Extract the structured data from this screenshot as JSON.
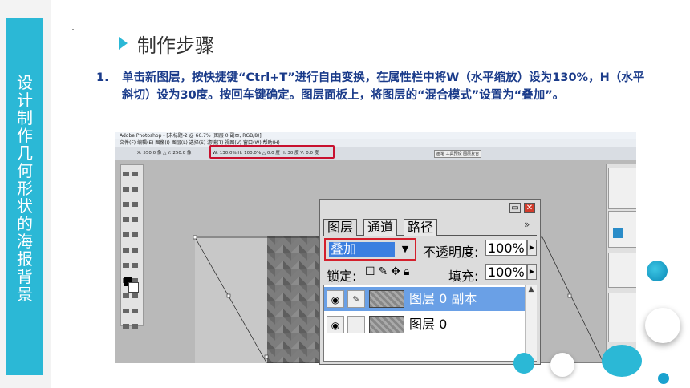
{
  "sidebar": {
    "title_chars": [
      "设",
      "计",
      "制",
      "作",
      "几",
      "何",
      "形",
      "状",
      "的",
      "海",
      "报",
      "背",
      "景"
    ]
  },
  "heading": {
    "text": "制作步骤"
  },
  "step": {
    "number": "1.",
    "text": "单击新图层，按快捷键“Ctrl+T”进行自由变换，在属性栏中将W（水平缩放）设为130%，H（水平斜切）设为30度。按回车键确定。图层面板上，将图层的“混合模式”设置为“叠加”。"
  },
  "screenshot": {
    "ps_title": "Adobe Photoshop - [未标题-2 @ 66.7% (图层 0 副本, RGB/8)]",
    "ps_menu": "文件(F)  编辑(E)  图像(I)  图层(L)  选择(S)  滤镜(T)  视图(V)  窗口(W)  帮助(H)",
    "opts_xy": "X: 550.0 像 △ Y: 250.0 像",
    "opts_wh": "W: 130.0%  H: 100.0%  △ 0.0  度  H: 30  度  V: 0.0  度",
    "opts_tabs": "画笔 工具预设 图层复合"
  },
  "layers_panel": {
    "tabs": [
      "图层",
      "通道",
      "路径"
    ],
    "more_label": "»",
    "blend_mode": "叠加",
    "opacity_label": "不透明度:",
    "opacity_value": "100%",
    "lock_label": "锁定:",
    "fill_label": "填充:",
    "fill_value": "100%",
    "layers": [
      {
        "name": "图层 0 副本",
        "selected": true
      },
      {
        "name": "图层 0",
        "selected": false
      }
    ]
  },
  "colors": {
    "accent": "#2bb8d6",
    "step_text": "#1a3b8a",
    "highlight_red": "#d4202c",
    "selected_blue": "#3b7fe0"
  }
}
